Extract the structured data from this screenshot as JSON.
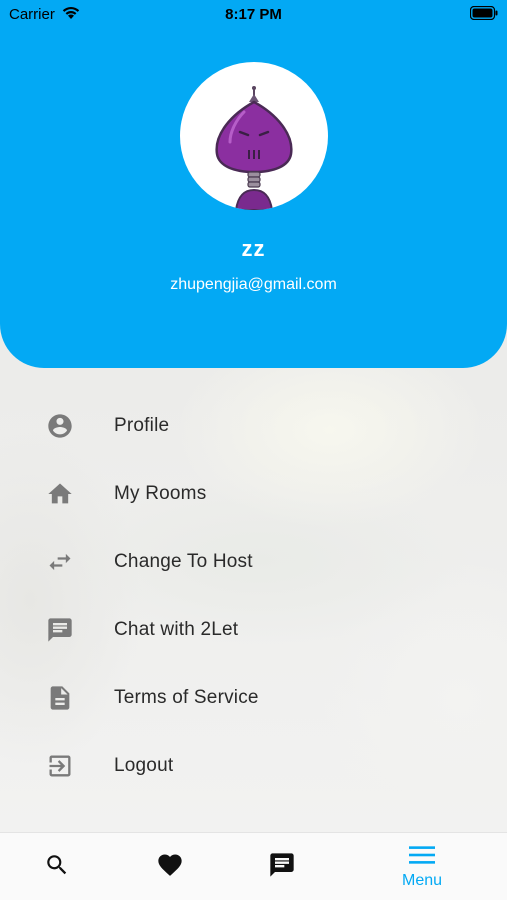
{
  "status_bar": {
    "carrier": "Carrier",
    "time": "8:17 PM"
  },
  "profile": {
    "name": "zz",
    "email": "zhupengjia@gmail.com",
    "avatar_icon": "purple-robot-avatar"
  },
  "menu": {
    "items": [
      {
        "label": "Profile",
        "icon": "account-circle-icon"
      },
      {
        "label": "My Rooms",
        "icon": "home-icon"
      },
      {
        "label": "Change To Host",
        "icon": "swap-arrows-icon"
      },
      {
        "label": "Chat with 2Let",
        "icon": "chat-icon"
      },
      {
        "label": "Terms of Service",
        "icon": "document-icon"
      },
      {
        "label": "Logout",
        "icon": "logout-icon"
      }
    ]
  },
  "tab_bar": {
    "tabs": [
      {
        "icon": "search-icon",
        "label": ""
      },
      {
        "icon": "heart-icon",
        "label": ""
      },
      {
        "icon": "message-icon",
        "label": ""
      },
      {
        "icon": "menu-icon",
        "label": "Menu",
        "active": true
      }
    ]
  },
  "colors": {
    "accent": "#03a9f4",
    "icon_gray": "#7a7a7a",
    "text_dark": "#2a2a2a"
  }
}
